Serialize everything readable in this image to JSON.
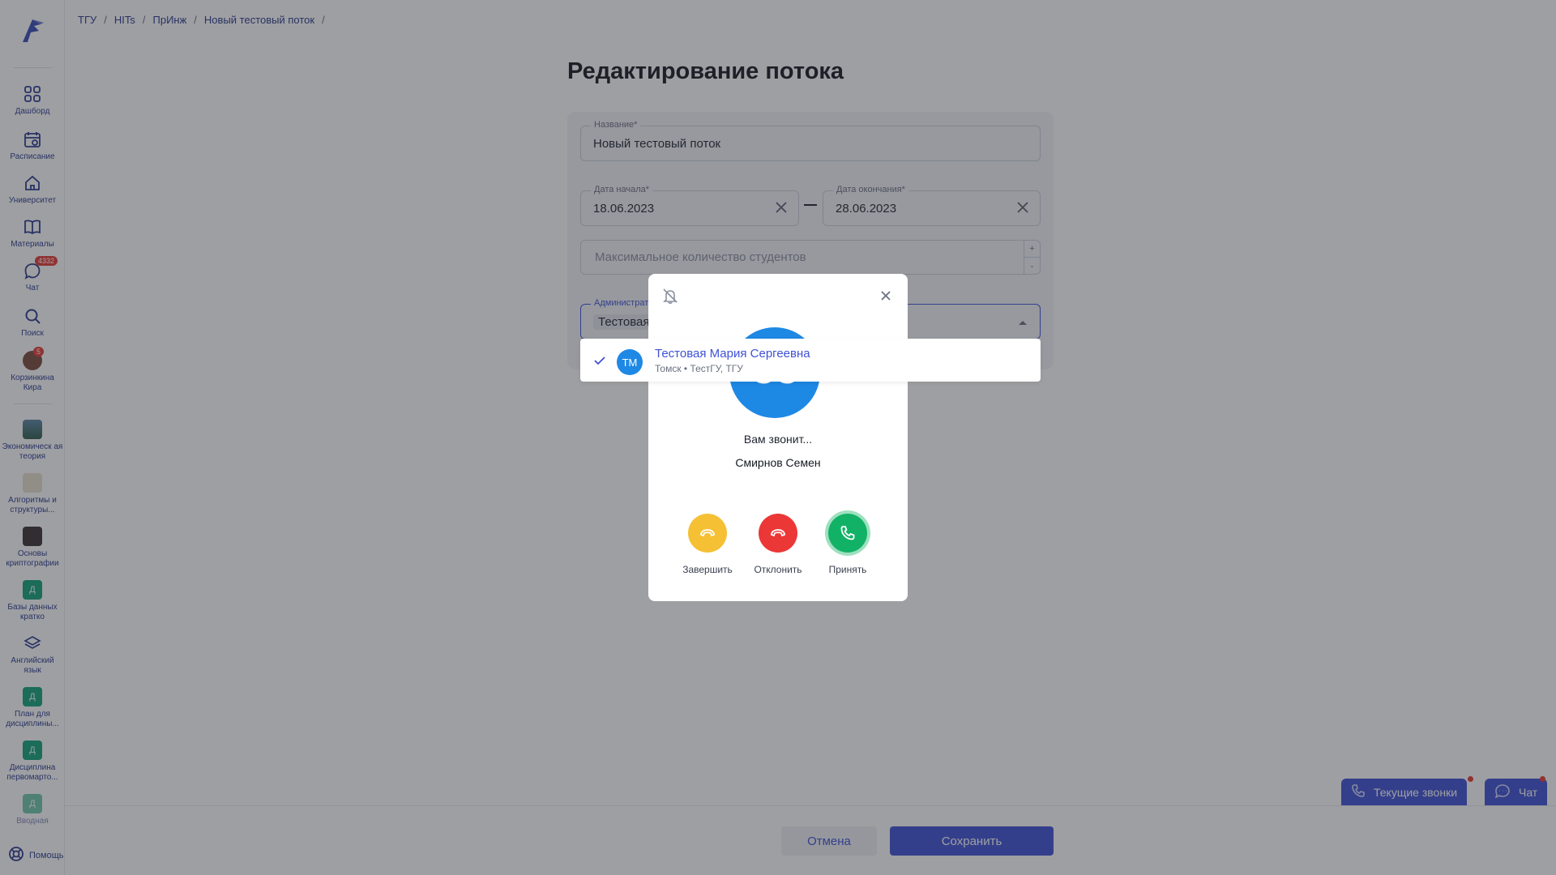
{
  "sidebar": {
    "items": [
      {
        "label": "Дашборд",
        "icon": "grid-icon"
      },
      {
        "label": "Расписание",
        "icon": "calendar-icon"
      },
      {
        "label": "Университет",
        "icon": "home-icon"
      },
      {
        "label": "Материалы",
        "icon": "book-icon"
      },
      {
        "label": "Чат",
        "icon": "chat-icon",
        "badge": "4332"
      },
      {
        "label": "Поиск",
        "icon": "search-icon"
      },
      {
        "label": "Корзинкина Кира",
        "icon": "avatar",
        "badge": "5"
      }
    ],
    "courses": [
      {
        "label": "Экономическ ая теория"
      },
      {
        "label": "Алгоритмы и структуры..."
      },
      {
        "label": "Основы криптографии"
      },
      {
        "label": "Базы данных кратко",
        "letter": "Д"
      },
      {
        "label": "Английский язык"
      },
      {
        "label": "План для дисциплины...",
        "letter": "Д"
      },
      {
        "label": "Дисциплина первомарто...",
        "letter": "Д"
      },
      {
        "label": "Вводная",
        "letter": "Д"
      }
    ],
    "help_label": "Помощь"
  },
  "breadcrumb": [
    "ТГУ",
    "HITs",
    "ПрИнж",
    "Новый тестовый поток"
  ],
  "page": {
    "title": "Редактирование потока"
  },
  "form": {
    "name_label": "Название*",
    "name_value": "Новый тестовый поток",
    "start_label": "Дата начала*",
    "start_value": "18.06.2023",
    "end_label": "Дата окончания*",
    "end_value": "28.06.2023",
    "max_students_placeholder": "Максимальное количество студентов",
    "stepper_plus": "+",
    "stepper_minus": "-",
    "admin_label": "Администрат",
    "admin_chip": "Тестовая"
  },
  "dropdown": {
    "initials": "ТМ",
    "name": "Тестовая Мария Сергеевна",
    "sub": "Томск • ТестГУ, ТГУ"
  },
  "call": {
    "avatar_initials": "СС",
    "calling_text": "Вам звонит...",
    "caller_name": "Смирнов Семен",
    "buttons": {
      "end": "Завершить",
      "decline": "Отклонить",
      "accept": "Принять"
    },
    "colors": {
      "end": "#f5c033",
      "decline": "#ec3737",
      "accept": "#12b266"
    }
  },
  "footer": {
    "cancel": "Отмена",
    "save": "Сохранить"
  },
  "widgets": {
    "calls": "Текущие звонки",
    "chat": "Чат"
  },
  "colors": {
    "accent": "#3f51d6",
    "badge": "#e53935",
    "avatar": "#1e88e5"
  }
}
